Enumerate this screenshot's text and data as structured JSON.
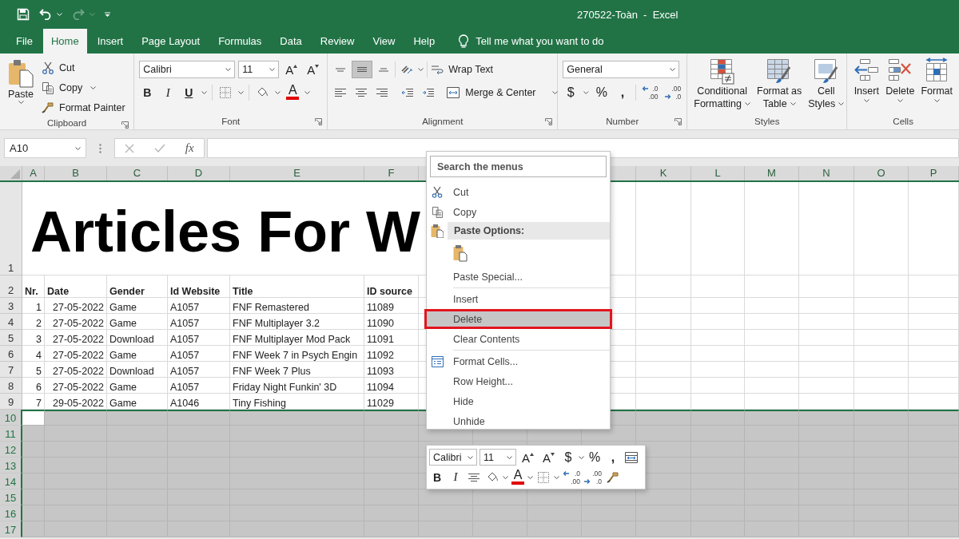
{
  "title_bar": {
    "title": "270522-Toàn  -  Excel",
    "redo_enabled": false
  },
  "tabs": [
    {
      "label": "File",
      "selected": false
    },
    {
      "label": "Home",
      "selected": true
    },
    {
      "label": "Insert",
      "selected": false
    },
    {
      "label": "Page Layout",
      "selected": false
    },
    {
      "label": "Formulas",
      "selected": false
    },
    {
      "label": "Data",
      "selected": false
    },
    {
      "label": "Review",
      "selected": false
    },
    {
      "label": "View",
      "selected": false
    },
    {
      "label": "Help",
      "selected": false
    }
  ],
  "tell_me": "Tell me what you want to do",
  "ribbon": {
    "clipboard": {
      "label": "Clipboard",
      "paste": "Paste",
      "cut": "Cut",
      "copy": "Copy",
      "format_painter": "Format Painter"
    },
    "font": {
      "label": "Font",
      "font_name": "Calibri",
      "font_size": "11",
      "grow": "A",
      "shrink": "A",
      "bold": "B",
      "italic": "I",
      "underline": "U",
      "font_color": "A"
    },
    "alignment": {
      "label": "Alignment",
      "wrap_text": "Wrap Text",
      "merge_center": "Merge & Center",
      "vertical": [
        {
          "kind": "top",
          "selected": false
        },
        {
          "kind": "middle",
          "selected": true
        },
        {
          "kind": "bottom",
          "selected": false
        }
      ]
    },
    "number": {
      "label": "Number",
      "format": "General",
      "currency": "$",
      "percent": "%",
      "comma": ",",
      "increase_decimal": {
        "top": ".0",
        "bottom": ".00"
      },
      "decrease_decimal": {
        "top": ".00",
        "bottom": ".0"
      }
    },
    "styles": {
      "label": "Styles",
      "buttons": [
        {
          "kind": "conditional",
          "lines": [
            "Conditional",
            "Formatting"
          ]
        },
        {
          "kind": "table",
          "lines": [
            "Format as",
            "Table"
          ]
        },
        {
          "kind": "cell",
          "lines": [
            "Cell",
            "Styles"
          ]
        }
      ]
    },
    "cells": {
      "label": "Cells",
      "buttons": [
        {
          "kind": "insert",
          "label": "Insert"
        },
        {
          "kind": "delete",
          "label": "Delete"
        },
        {
          "kind": "format",
          "label": "Format"
        }
      ]
    }
  },
  "formula_bar": {
    "name_box": "A10",
    "function_symbol": "fx"
  },
  "sheet": {
    "columns": [
      "A",
      "B",
      "C",
      "D",
      "E",
      "F",
      "K",
      "L",
      "M",
      "N",
      "O",
      "P"
    ],
    "rows": [
      {
        "label": "1",
        "selected": false
      },
      {
        "label": "2",
        "selected": false
      },
      {
        "label": "3",
        "selected": false
      },
      {
        "label": "4",
        "selected": false
      },
      {
        "label": "5",
        "selected": false
      },
      {
        "label": "6",
        "selected": false
      },
      {
        "label": "7",
        "selected": false
      },
      {
        "label": "8",
        "selected": false
      },
      {
        "label": "9",
        "selected": false
      },
      {
        "label": "10",
        "selected": true
      },
      {
        "label": "11",
        "selected": true
      },
      {
        "label": "12",
        "selected": true
      },
      {
        "label": "13",
        "selected": true
      },
      {
        "label": "14",
        "selected": true
      },
      {
        "label": "15",
        "selected": true
      },
      {
        "label": "16",
        "selected": true
      },
      {
        "label": "17",
        "selected": true
      }
    ],
    "title": "Articles For W",
    "header": [
      "Nr.",
      "Date",
      "Gender",
      "Id Website",
      "Title",
      "ID source"
    ],
    "records": [
      [
        "1",
        "27-05-2022",
        "Game",
        "A1057",
        "FNF Remastered",
        "11089"
      ],
      [
        "2",
        "27-05-2022",
        "Game",
        "A1057",
        "FNF Multiplayer 3.2",
        "11090"
      ],
      [
        "3",
        "27-05-2022",
        "Download",
        "A1057",
        "FNF Multiplayer Mod Pack",
        "11091"
      ],
      [
        "4",
        "27-05-2022",
        "Game",
        "A1057",
        "FNF Week 7 in Psych Engin",
        "11092"
      ],
      [
        "5",
        "27-05-2022",
        "Download",
        "A1057",
        "FNF Week 7 Plus",
        "11093"
      ],
      [
        "6",
        "27-05-2022",
        "Game",
        "A1057",
        "Friday Night Funkin' 3D",
        "11094"
      ],
      [
        "7",
        "29-05-2022",
        "Game",
        "A1046",
        "Tiny Fishing",
        "11029"
      ]
    ]
  },
  "context_menu": {
    "search_placeholder": "Search the menus",
    "items": [
      {
        "kind": "cut",
        "label": "Cut",
        "selected": false
      },
      {
        "kind": "copy",
        "label": "Copy",
        "selected": false
      },
      {
        "kind": "header",
        "label": "Paste Options:"
      },
      {
        "kind": "paste-options"
      },
      {
        "kind": "command",
        "label": "Paste Special...",
        "selected": false
      },
      {
        "kind": "separator"
      },
      {
        "kind": "command",
        "label": "Insert",
        "selected": false
      },
      {
        "kind": "command",
        "label": "Delete",
        "selected": true
      },
      {
        "kind": "command",
        "label": "Clear Contents",
        "selected": false
      },
      {
        "kind": "separator"
      },
      {
        "kind": "format",
        "label": "Format Cells...",
        "selected": false
      },
      {
        "kind": "command",
        "label": "Row Height...",
        "selected": false
      },
      {
        "kind": "command",
        "label": "Hide",
        "selected": false
      },
      {
        "kind": "command",
        "label": "Unhide",
        "selected": false
      }
    ]
  },
  "mini_toolbar": {
    "font_name": "Calibri",
    "font_size": "11",
    "grow": "A",
    "shrink": "A",
    "currency": "$",
    "percent": "%",
    "comma": ",",
    "bold": "B",
    "italic": "I",
    "font_color": "A",
    "increase_decimal": {
      "top": ".0",
      "bottom": ".00"
    },
    "decrease_decimal": {
      "top": ".00",
      "bottom": ".0"
    }
  }
}
